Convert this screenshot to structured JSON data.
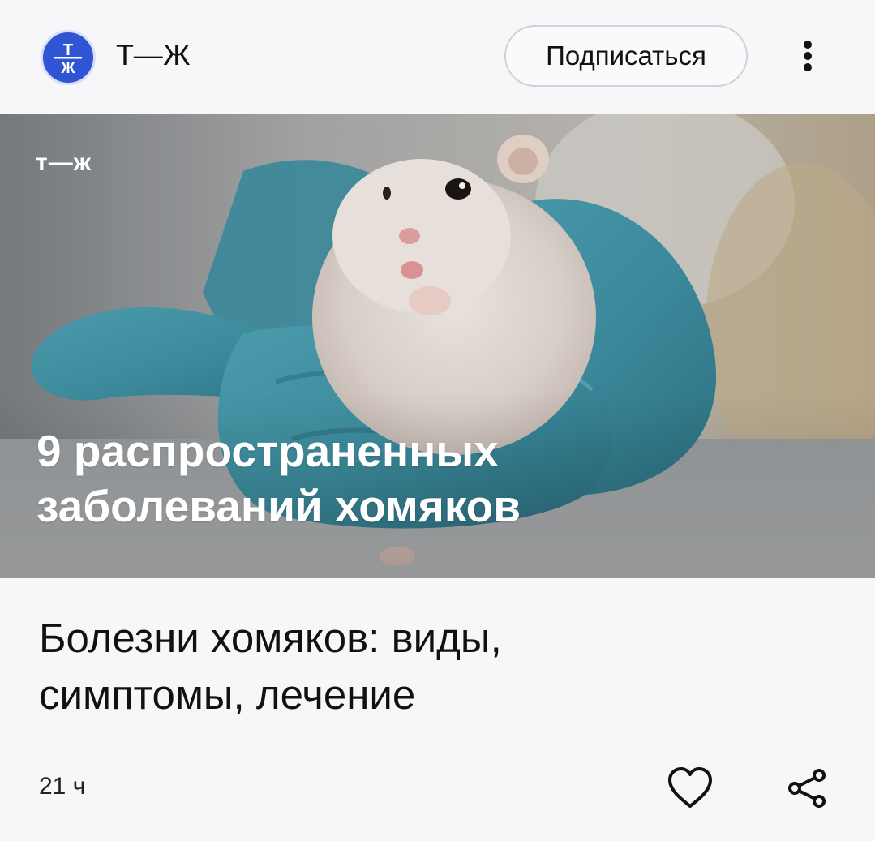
{
  "channel": {
    "logo_text_top": "Т",
    "logo_text_bottom": "Ж",
    "name": "Т—Ж",
    "brand_color": "#2f55d4"
  },
  "header": {
    "subscribe_label": "Подписаться",
    "more_icon": "more-vertical-icon"
  },
  "cover": {
    "logo": "т—ж",
    "title_line1": "9 распространенных",
    "title_line2": "заболеваний хомяков",
    "glove_color": "#3f93a6"
  },
  "article": {
    "title_line1": "Болезни хомяков: виды,",
    "title_line2": "симптомы, лечение",
    "time": "21 ч"
  },
  "actions": {
    "like_icon": "heart-icon",
    "share_icon": "share-icon"
  }
}
